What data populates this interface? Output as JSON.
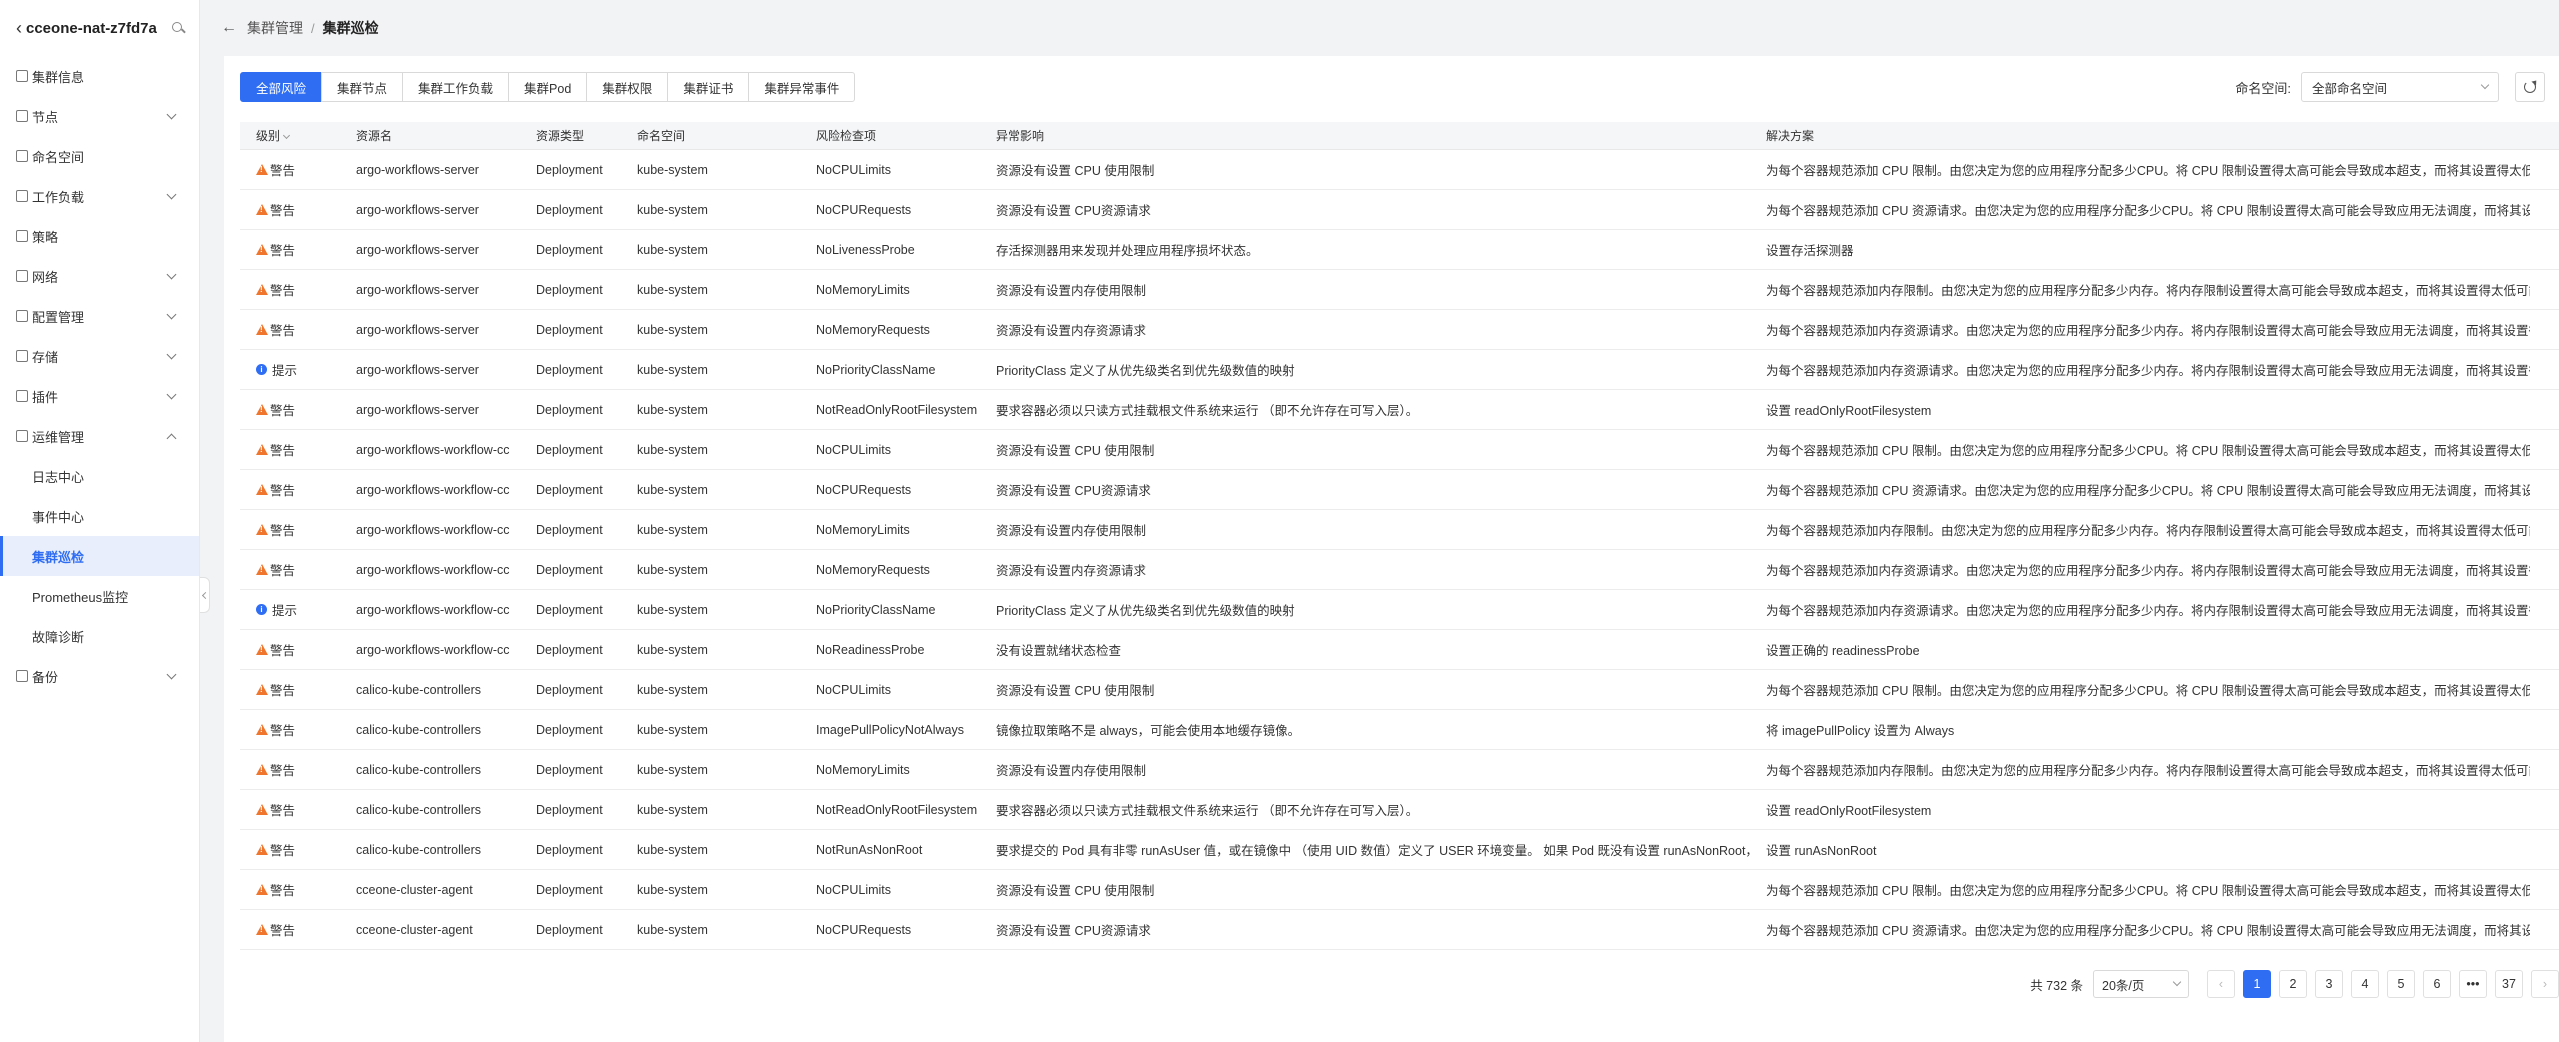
{
  "sidebar": {
    "cluster_name": "cceone-nat-z7fd7a",
    "items": [
      {
        "label": "集群信息",
        "expandable": false
      },
      {
        "label": "节点",
        "expandable": true
      },
      {
        "label": "命名空间",
        "expandable": false
      },
      {
        "label": "工作负载",
        "expandable": true
      },
      {
        "label": "策略",
        "expandable": false
      },
      {
        "label": "网络",
        "expandable": true
      },
      {
        "label": "配置管理",
        "expandable": true
      },
      {
        "label": "存储",
        "expandable": true
      },
      {
        "label": "插件",
        "expandable": true
      },
      {
        "label": "运维管理",
        "expandable": true,
        "expanded": true
      }
    ],
    "ops_sub": [
      "日志中心",
      "事件中心",
      "集群巡检",
      "Prometheus监控",
      "故障诊断"
    ],
    "last_item": "备份"
  },
  "breadcrumb": {
    "parent": "集群管理",
    "current": "集群巡检"
  },
  "tabs": [
    "全部风险",
    "集群节点",
    "集群工作负载",
    "集群Pod",
    "集群权限",
    "集群证书",
    "集群异常事件"
  ],
  "namespace": {
    "label": "命名空间:",
    "value": "全部命名空间"
  },
  "table": {
    "headers": [
      "级别",
      "资源名",
      "资源类型",
      "命名空间",
      "风险检查项",
      "异常影响",
      "解决方案"
    ],
    "rows": [
      [
        "警告",
        "argo-workflows-server",
        "Deployment",
        "kube-system",
        "NoCPULimits",
        "资源没有设置 CPU 使用限制",
        "为每个容器规范添加 CPU 限制。由您决定为您的应用程序分配多少CPU。将 CPU 限制设置得太高可能会导致成本超支，而将其设置得太低可能会"
      ],
      [
        "警告",
        "argo-workflows-server",
        "Deployment",
        "kube-system",
        "NoCPURequests",
        "资源没有设置 CPU资源请求",
        "为每个容器规范添加 CPU 资源请求。由您决定为您的应用程序分配多少CPU。将 CPU 限制设置得太高可能会导致应用无法调度，而将其设置得太低可"
      ],
      [
        "警告",
        "argo-workflows-server",
        "Deployment",
        "kube-system",
        "NoLivenessProbe",
        "存活探测器用来发现并处理应用程序损坏状态。",
        "设置存活探测器"
      ],
      [
        "警告",
        "argo-workflows-server",
        "Deployment",
        "kube-system",
        "NoMemoryLimits",
        "资源没有设置内存使用限制",
        "为每个容器规范添加内存限制。由您决定为您的应用程序分配多少内存。将内存限制设置得太高可能会导致成本超支，而将其设置得太低可能会"
      ],
      [
        "警告",
        "argo-workflows-server",
        "Deployment",
        "kube-system",
        "NoMemoryRequests",
        "资源没有设置内存资源请求",
        "为每个容器规范添加内存资源请求。由您决定为您的应用程序分配多少内存。将内存限制设置得太高可能会导致应用无法调度，而将其设置得太"
      ],
      [
        "提示",
        "argo-workflows-server",
        "Deployment",
        "kube-system",
        "NoPriorityClassName",
        "PriorityClass 定义了从优先级类名到优先级数值的映射",
        "为每个容器规范添加内存资源请求。由您决定为您的应用程序分配多少内存。将内存限制设置得太高可能会导致应用无法调度，而将其设置得太"
      ],
      [
        "警告",
        "argo-workflows-server",
        "Deployment",
        "kube-system",
        "NotReadOnlyRootFilesystem",
        "要求容器必须以只读方式挂载根文件系统来运行 （即不允许存在可写入层）。",
        "设置 readOnlyRootFilesystem"
      ],
      [
        "警告",
        "argo-workflows-workflow-cc",
        "Deployment",
        "kube-system",
        "NoCPULimits",
        "资源没有设置 CPU 使用限制",
        "为每个容器规范添加 CPU 限制。由您决定为您的应用程序分配多少CPU。将 CPU 限制设置得太高可能会导致成本超支，而将其设置得太低可能会"
      ],
      [
        "警告",
        "argo-workflows-workflow-cc",
        "Deployment",
        "kube-system",
        "NoCPURequests",
        "资源没有设置 CPU资源请求",
        "为每个容器规范添加 CPU 资源请求。由您决定为您的应用程序分配多少CPU。将 CPU 限制设置得太高可能会导致应用无法调度，而将其设置得太低可"
      ],
      [
        "警告",
        "argo-workflows-workflow-cc",
        "Deployment",
        "kube-system",
        "NoMemoryLimits",
        "资源没有设置内存使用限制",
        "为每个容器规范添加内存限制。由您决定为您的应用程序分配多少内存。将内存限制设置得太高可能会导致成本超支，而将其设置得太低可能会"
      ],
      [
        "警告",
        "argo-workflows-workflow-cc",
        "Deployment",
        "kube-system",
        "NoMemoryRequests",
        "资源没有设置内存资源请求",
        "为每个容器规范添加内存资源请求。由您决定为您的应用程序分配多少内存。将内存限制设置得太高可能会导致应用无法调度，而将其设置得太"
      ],
      [
        "提示",
        "argo-workflows-workflow-cc",
        "Deployment",
        "kube-system",
        "NoPriorityClassName",
        "PriorityClass 定义了从优先级类名到优先级数值的映射",
        "为每个容器规范添加内存资源请求。由您决定为您的应用程序分配多少内存。将内存限制设置得太高可能会导致应用无法调度，而将其设置得太"
      ],
      [
        "警告",
        "argo-workflows-workflow-cc",
        "Deployment",
        "kube-system",
        "NoReadinessProbe",
        "没有设置就绪状态检查",
        "设置正确的 readinessProbe"
      ],
      [
        "警告",
        "calico-kube-controllers",
        "Deployment",
        "kube-system",
        "NoCPULimits",
        "资源没有设置 CPU 使用限制",
        "为每个容器规范添加 CPU 限制。由您决定为您的应用程序分配多少CPU。将 CPU 限制设置得太高可能会导致成本超支，而将其设置得太低可能会"
      ],
      [
        "警告",
        "calico-kube-controllers",
        "Deployment",
        "kube-system",
        "ImagePullPolicyNotAlways",
        "镜像拉取策略不是 always，可能会使用本地缓存镜像。",
        "将 imagePullPolicy 设置为 Always"
      ],
      [
        "警告",
        "calico-kube-controllers",
        "Deployment",
        "kube-system",
        "NoMemoryLimits",
        "资源没有设置内存使用限制",
        "为每个容器规范添加内存限制。由您决定为您的应用程序分配多少内存。将内存限制设置得太高可能会导致成本超支，而将其设置得太低可能会"
      ],
      [
        "警告",
        "calico-kube-controllers",
        "Deployment",
        "kube-system",
        "NotReadOnlyRootFilesystem",
        "要求容器必须以只读方式挂载根文件系统来运行 （即不允许存在可写入层）。",
        "设置 readOnlyRootFilesystem"
      ],
      [
        "警告",
        "calico-kube-controllers",
        "Deployment",
        "kube-system",
        "NotRunAsNonRoot",
        "要求提交的 Pod 具有非零 runAsUser 值，或在镜像中 （使用 UID 数值）定义了 USER 环境变量。 如果 Pod 既没有设置 runAsNonRoot，也没",
        "设置 runAsNonRoot"
      ],
      [
        "警告",
        "cceone-cluster-agent",
        "Deployment",
        "kube-system",
        "NoCPULimits",
        "资源没有设置 CPU 使用限制",
        "为每个容器规范添加 CPU 限制。由您决定为您的应用程序分配多少CPU。将 CPU 限制设置得太高可能会导致成本超支，而将其设置得太低可能会"
      ],
      [
        "警告",
        "cceone-cluster-agent",
        "Deployment",
        "kube-system",
        "NoCPURequests",
        "资源没有设置 CPU资源请求",
        "为每个容器规范添加 CPU 资源请求。由您决定为您的应用程序分配多少CPU。将 CPU 限制设置得太高可能会导致应用无法调度，而将其设置得太低可"
      ]
    ]
  },
  "pagination": {
    "total": "共 732 条",
    "page_size": "20条/页",
    "pages": [
      "1",
      "2",
      "3",
      "4",
      "5",
      "6",
      "•••",
      "37"
    ],
    "current": "1"
  },
  "colors": {
    "accent": "#2f6ef3",
    "warning": "#f0762e",
    "info": "#2f6ef3"
  }
}
